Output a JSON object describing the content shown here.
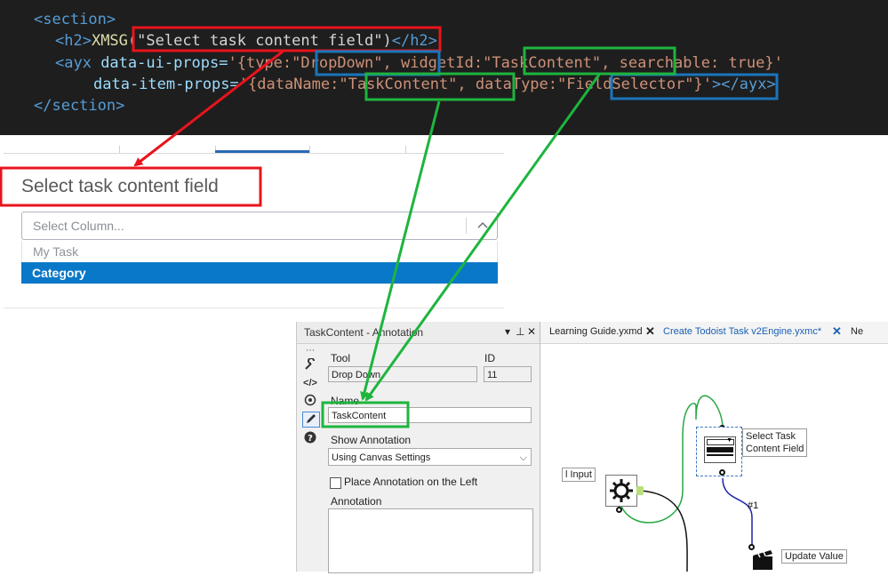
{
  "code": {
    "line1": "<section>",
    "line2_open": "<h2>",
    "line2_fn": "XMSG",
    "line2_arg": "(\"Select task content field\")",
    "line2_close": "</h2>",
    "line3_tag": "<ayx",
    "line3_attr": " data-ui-props=",
    "line3_p1": "'{type:",
    "line3_v1": "\"DropDown\",",
    "line3_p2": " widgetId:",
    "line3_v2": "\"TaskContent\",",
    "line3_p3": " searchable: true}'",
    "line4_attr": "data-item-props=",
    "line4_p1": "'{dataName:",
    "line4_v1": "\"TaskContent\",",
    "line4_p2": " dataType:",
    "line4_v2": "\"FieldSelector\"",
    "line4_p3": "}'",
    "line4_close": "></ayx>",
    "line5": "</section>"
  },
  "dropdown_preview": {
    "title": "Select task content field",
    "placeholder": "Select Column...",
    "options": [
      {
        "label": "My Task",
        "selected": false
      },
      {
        "label": "Category",
        "selected": true
      }
    ]
  },
  "config_window": {
    "title": "TaskContent - Annotation",
    "title_controls": [
      "▾",
      "⊥",
      "✕"
    ],
    "tool_label": "Tool",
    "tool_value": "Drop Down",
    "id_label": "ID",
    "id_value": "11",
    "name_label": "Name",
    "name_value": "TaskContent",
    "show_annotation_label": "Show Annotation",
    "show_annotation_value": "Using Canvas Settings",
    "place_left_label": "Place Annotation on the Left",
    "annotation_label": "Annotation"
  },
  "canvas": {
    "tabs": [
      {
        "label": "Learning Guide.yxmd",
        "active": false
      },
      {
        "label": "Create Todoist Task v2Engine.yxmc*",
        "active": true
      },
      {
        "label": "Ne",
        "active": false
      }
    ],
    "labels": {
      "input": "l Input",
      "select_task": "Select Task\nContent Field",
      "update_value": "Update Value",
      "connection": "#1"
    }
  },
  "colors": {
    "red": "#e8141c",
    "green": "#1db53d",
    "blue": "#1b75bc",
    "accent_blue": "#0a78c8"
  }
}
